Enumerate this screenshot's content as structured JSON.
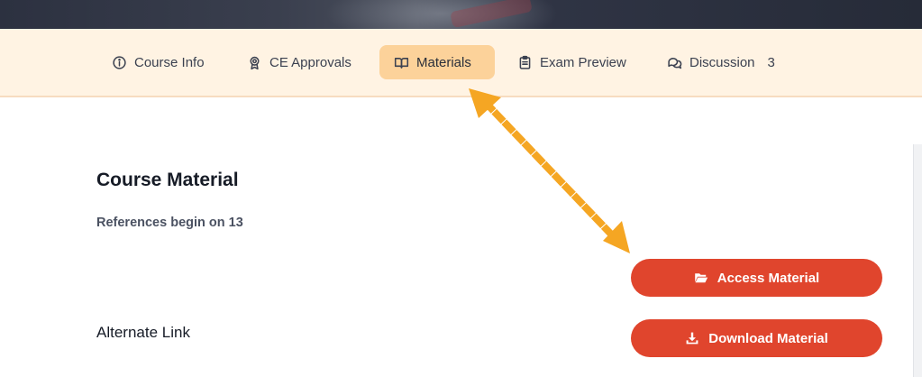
{
  "tabs": [
    {
      "id": "course-info",
      "label": "Course Info",
      "icon": "info-circle-icon"
    },
    {
      "id": "ce-approvals",
      "label": "CE Approvals",
      "icon": "award-ribbon-icon"
    },
    {
      "id": "materials",
      "label": "Materials",
      "icon": "open-book-icon",
      "active": true
    },
    {
      "id": "exam-preview",
      "label": "Exam Preview",
      "icon": "clipboard-icon"
    },
    {
      "id": "discussion",
      "label": "Discussion",
      "icon": "chat-bubbles-icon",
      "count": "3"
    }
  ],
  "content": {
    "title": "Course Material",
    "subtitle": "References begin on 13",
    "alternate_label": "Alternate Link"
  },
  "buttons": {
    "access": {
      "label": "Access Material",
      "icon": "folder-open-icon"
    },
    "download": {
      "label": "Download Material",
      "icon": "download-icon"
    }
  },
  "colors": {
    "tabbar_bg": "#fff3e3",
    "active_tab_bg": "#fcd29a",
    "button_red": "#e0452d",
    "annotation_arrow": "#f5a623"
  },
  "annotation": {
    "type": "dotted-double-arrow",
    "from": "tab-materials",
    "to": "access-material-button"
  }
}
